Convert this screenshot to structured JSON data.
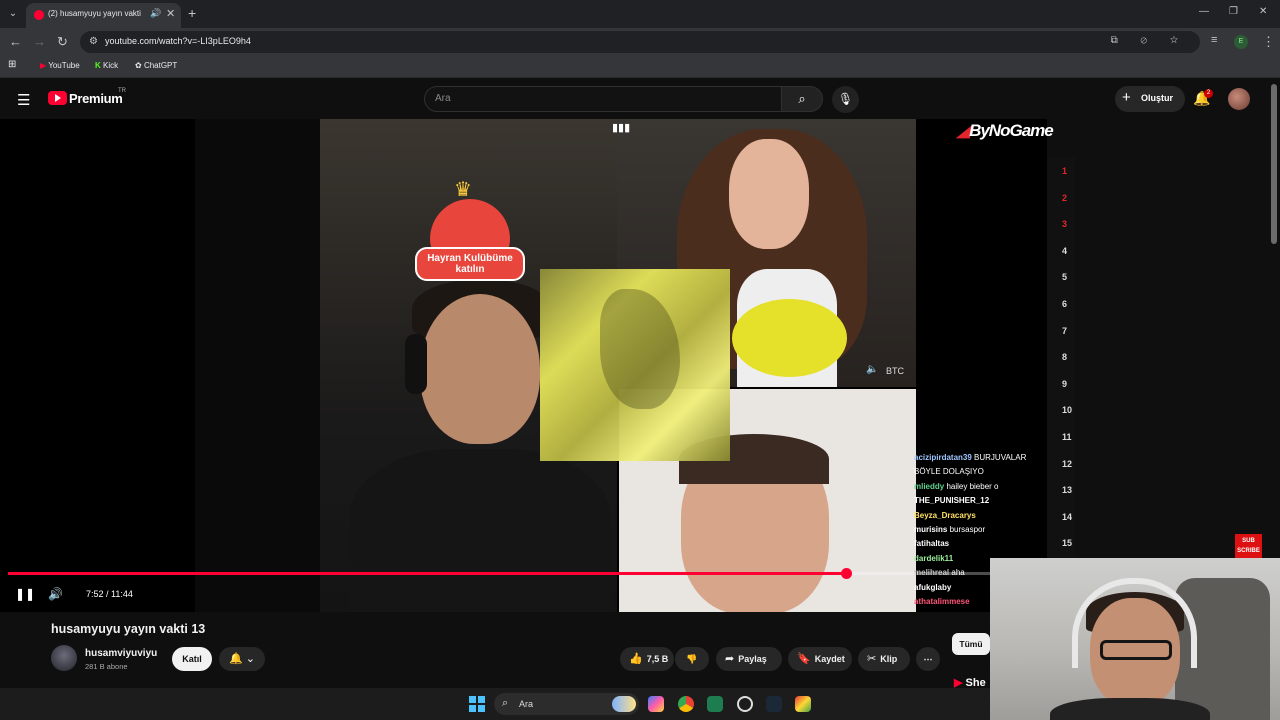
{
  "browser": {
    "tab_title": "(2) husamyuyu yayın vakti 1",
    "url": "youtube.com/watch?v=-LI3pLEO9h4",
    "bookmarks": [
      "YouTube",
      "Kick",
      "ChatGPT"
    ],
    "profile_initial": "E"
  },
  "header": {
    "brand": "Premium",
    "region": "TR",
    "search_placeholder": "Ara",
    "create_label": "Oluştur",
    "notification_count": "2"
  },
  "player": {
    "time_display": "7:52 / 11:44",
    "progress_fraction": 0.67,
    "fanclub_text": "Hayran Kulübüme katılın",
    "cam_label": "BTC",
    "overlay_brand": "ByNoGame",
    "ranks": [
      "1",
      "2",
      "3",
      "4",
      "5",
      "6",
      "7",
      "8",
      "9",
      "10",
      "11",
      "12",
      "13",
      "14",
      "15"
    ],
    "sub_badge": "SUB SCRIBE",
    "chat": [
      {
        "user": "acizipirdatan39",
        "msg": "BURJUVALAR",
        "color": "#9ec7ff"
      },
      {
        "user": "",
        "msg": "BÖYLE DOLAŞIYO",
        "color": "#ffffff"
      },
      {
        "user": "mlieddy",
        "msg": "hailey bieber o",
        "color": "#5fd38d"
      },
      {
        "user": "THE_PUNISHER_12",
        "msg": "",
        "color": "#ffffff"
      },
      {
        "user": "Beyza_Dracarys",
        "msg": "",
        "color": "#ffe066"
      },
      {
        "user": "murisins",
        "msg": "bursaspor",
        "color": "#ffffff"
      },
      {
        "user": "fatihaltas",
        "msg": "",
        "color": "#ffffff"
      },
      {
        "user": "dardelik11",
        "msg": "",
        "color": "#9ef09e"
      },
      {
        "user": "melihreal",
        "msg": "aha",
        "color": "#bbbbbb"
      },
      {
        "user": "afukglaby",
        "msg": "",
        "color": "#ffffff"
      },
      {
        "user": "athatalimmese",
        "msg": "",
        "color": "#ff5577"
      }
    ]
  },
  "video": {
    "title": "husamyuyu yayın vakti 13",
    "channel": "husamviyuviyu",
    "subscribers": "281 B abone",
    "join_label": "Katıl",
    "like_count": "7,5 B",
    "share_label": "Paylaş",
    "save_label": "Kaydet",
    "clip_label": "Klip",
    "filter_all": "Tümü",
    "shorts_label": "She"
  },
  "taskbar": {
    "search_placeholder": "Ara"
  }
}
